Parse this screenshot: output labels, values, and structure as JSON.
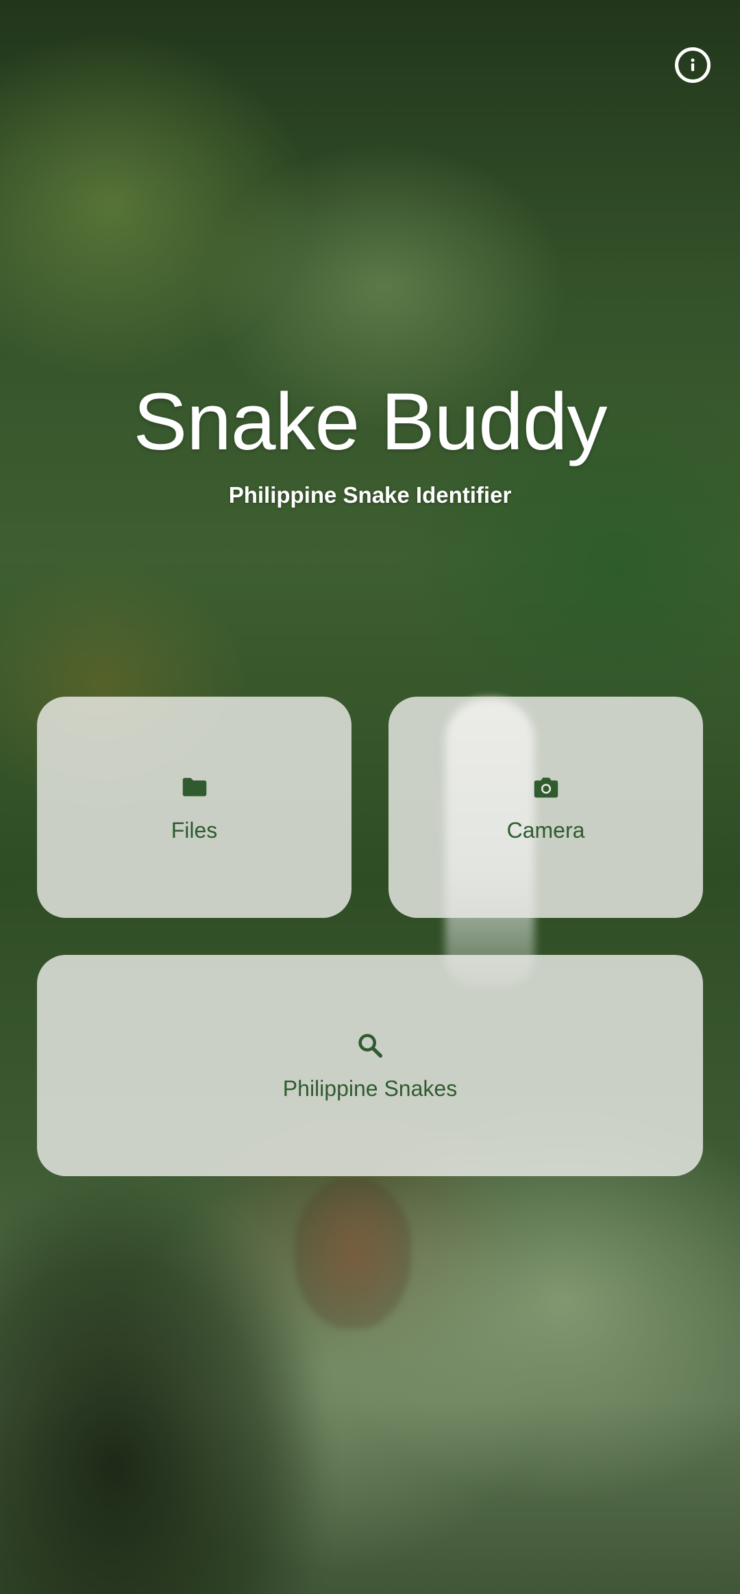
{
  "header": {
    "info_icon": "info-icon"
  },
  "hero": {
    "title": "Snake Buddy",
    "subtitle": "Philippine Snake Identifier"
  },
  "actions": {
    "files": {
      "label": "Files",
      "icon": "folder-icon"
    },
    "camera": {
      "label": "Camera",
      "icon": "camera-icon"
    },
    "snakes": {
      "label": "Philippine Snakes",
      "icon": "search-icon"
    }
  },
  "colors": {
    "card_background": "#ECECE8",
    "accent_green": "#2F5B2F",
    "title_text": "#FFFFFF"
  }
}
